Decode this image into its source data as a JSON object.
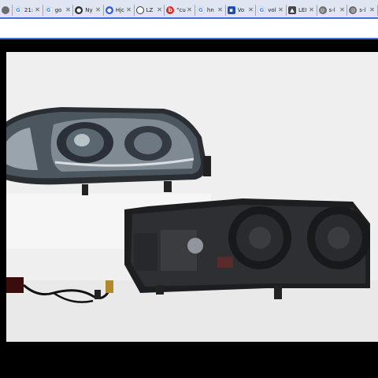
{
  "tabs": [
    {
      "icon": "blank-icon",
      "label": ""
    },
    {
      "icon": "google-icon",
      "label": "21:"
    },
    {
      "icon": "google-icon",
      "label": "go"
    },
    {
      "icon": "site-icon",
      "label": "Ny"
    },
    {
      "icon": "site-icon",
      "label": "Hjc"
    },
    {
      "icon": "site-icon",
      "label": "LZ"
    },
    {
      "icon": "site-icon",
      "label": "\"cu"
    },
    {
      "icon": "google-icon",
      "label": "hn"
    },
    {
      "icon": "site-icon",
      "label": "Vo"
    },
    {
      "icon": "google-icon",
      "label": "vol"
    },
    {
      "icon": "site-icon",
      "label": "LEI"
    },
    {
      "icon": "site-icon",
      "label": "s-l"
    },
    {
      "icon": "site-icon",
      "label": "s-l"
    }
  ],
  "colors": {
    "tabbar": "#dfe6f1",
    "toolbar_border": "#3f6fe0",
    "frame": "#000000"
  }
}
